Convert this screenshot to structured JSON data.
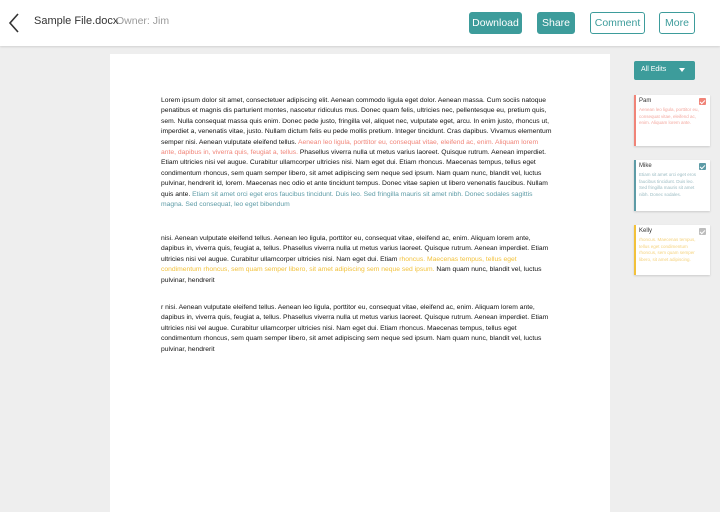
{
  "header": {
    "back_icon": "chevron-left-icon",
    "file_name": "Sample File.docx",
    "owner": "Owner: Jim",
    "buttons": {
      "download": "Download",
      "share": "Share",
      "comment": "Comment",
      "more": "More"
    }
  },
  "document": {
    "paragraphs": [
      {
        "segments": [
          {
            "text": "Lorem ipsum dolor sit amet, consectetuer adipiscing elit. Aenean commodo ligula eget dolor. Aenean massa. Cum sociis natoque penatibus et magnis dis parturient montes, nascetur ridiculus mus. Donec quam felis, ultricies nec, pellentesque eu, pretium quis, sem. Nulla consequat massa quis enim. Donec pede justo, fringilla vel, aliquet nec, vulputate eget, arcu. In enim justo, rhoncus ut, imperdiet a, venenatis vitae, justo. Nullam dictum felis eu pede mollis pretium. Integer tincidunt. Cras dapibus. Vivamus elementum semper nisi. Aenean vulputate eleifend tellus. ",
            "editor": ""
          },
          {
            "text": "Aenean leo ligula, porttitor eu, consequat vitae, eleifend ac, enim. Aliquam lorem ante, dapibus in, viverra quis, feugiat a, tellus.",
            "editor": "red"
          },
          {
            "text": " Phasellus viverra nulla ut metus varius laoreet. Quisque rutrum. Aenean imperdiet. Etiam ultricies nisi vel augue. Curabitur ullamcorper ultricies nisi. Nam eget dui. Etiam rhoncus. Maecenas tempus, tellus eget condimentum rhoncus, sem quam semper libero, sit amet adipiscing sem neque sed ipsum. Nam quam nunc, blandit vel, luctus pulvinar, hendrerit id, lorem. Maecenas nec odio et ante tincidunt tempus. Donec vitae sapien ut libero venenatis faucibus. Nullam quis ante. ",
            "editor": ""
          },
          {
            "text": "Etiam sit amet orci eget eros faucibus tincidunt. Duis leo. Sed fringilla mauris sit amet nibh. Donec sodales sagittis magna. Sed consequat, leo eget bibendum",
            "editor": "teal"
          }
        ]
      },
      {
        "segments": [
          {
            "text": "nisi. Aenean vulputate eleifend tellus. Aenean leo ligula, porttitor eu, consequat vitae, eleifend ac, enim. Aliquam lorem ante, dapibus in, viverra quis, feugiat a, tellus. Phasellus viverra nulla ut metus varius laoreet. Quisque rutrum. Aenean imperdiet. Etiam ultricies nisi vel augue. Curabitur ullamcorper ultricies nisi. Nam eget dui. Etiam ",
            "editor": ""
          },
          {
            "text": "rhoncus. Maecenas tempus, tellus eget condimentum rhoncus, sem quam semper libero, sit amet adipiscing sem neque sed ipsum.",
            "editor": "yellow"
          },
          {
            "text": " Nam quam nunc, blandit vel, luctus pulvinar, hendrerit",
            "editor": ""
          }
        ]
      },
      {
        "segments": [
          {
            "text": "r nisi. Aenean vulputate eleifend tellus. Aenean leo ligula, porttitor eu, consequat vitae, eleifend ac, enim. Aliquam lorem ante, dapibus in, viverra quis, feugiat a, tellus. Phasellus viverra nulla ut metus varius laoreet. Quisque rutrum. Aenean imperdiet. Etiam ultricies nisi vel augue. Curabitur ullamcorper ultricies nisi. Nam eget dui. Etiam rhoncus. Maecenas tempus, tellus eget condimentum rhoncus, sem quam semper libero, sit amet adipiscing sem neque sed ipsum. Nam quam nunc, blandit vel, luctus pulvinar, hendrerit",
            "editor": ""
          }
        ]
      }
    ]
  },
  "edits_panel": {
    "filter_label": "All Edits",
    "filter_icon": "caret-down-icon",
    "cards": [
      {
        "name": "Pam",
        "checked": true,
        "color": "#f08478",
        "preview": "Aenean leo ligula, porttitor eu, consequat vitae, eleifend ac, enim. Aliquam lorem ante."
      },
      {
        "name": "Mike",
        "checked": true,
        "color": "#5d9ba6",
        "preview": "Etiam sit amet orci eget eros faucibus tincidunt. Duis leo. Sed fringilla mauris sit amet nibh. Donec sodales."
      },
      {
        "name": "Kelly",
        "checked": false,
        "color": "#f2c13a",
        "preview": "rhoncus. Maecenas tempus, tellus eget condimentum rhoncus, sem quam semper libero, sit amet adipiscing."
      }
    ]
  },
  "colors": {
    "accent": "#3d9c9b",
    "pam": "#f08478",
    "mike": "#5d9ba6",
    "kelly": "#f2c13a"
  }
}
